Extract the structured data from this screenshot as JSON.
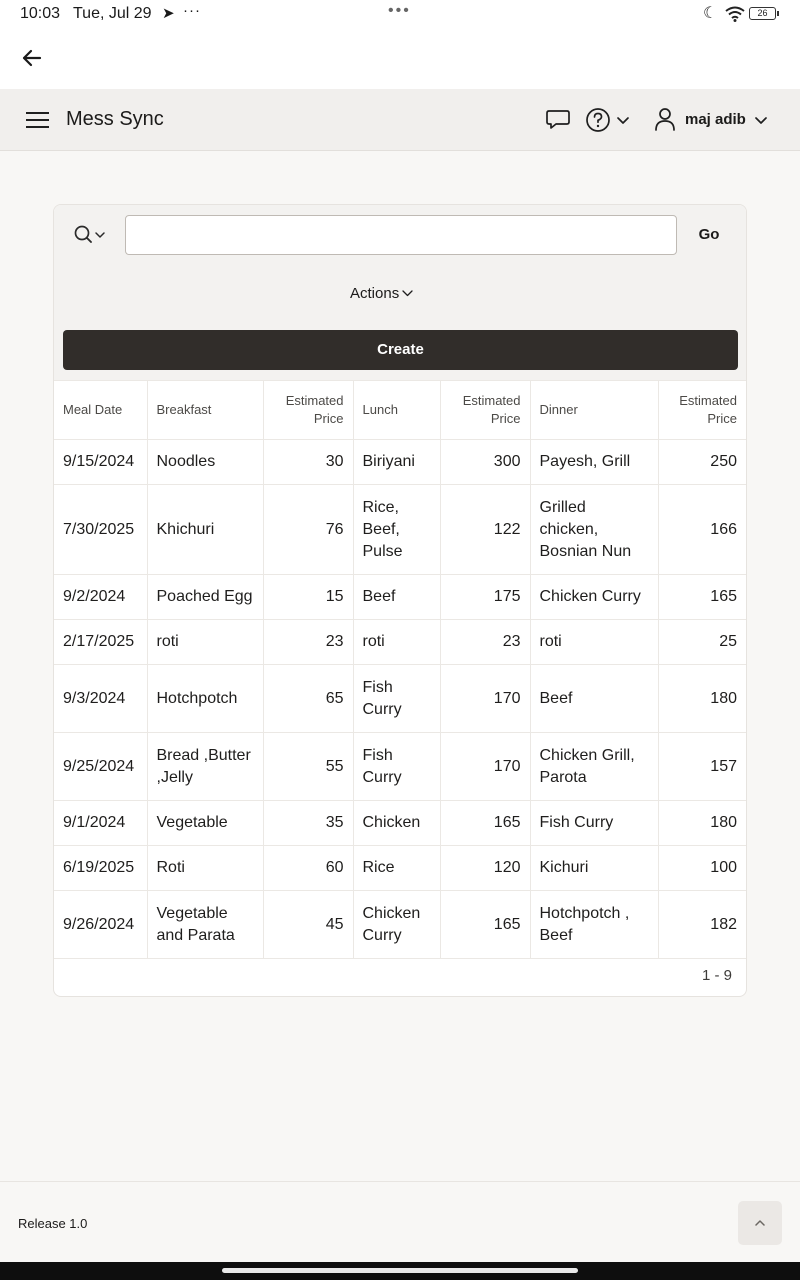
{
  "status": {
    "time": "10:03",
    "date": "Tue, Jul 29",
    "more": "···",
    "center_dots": "•••",
    "battery": "26"
  },
  "header": {
    "app_title": "Mess Sync",
    "user_name": "maj adib"
  },
  "toolbar": {
    "search_value": "",
    "go_label": "Go",
    "actions_label": "Actions",
    "create_label": "Create"
  },
  "table": {
    "columns": [
      {
        "label": "Meal Date",
        "numeric": false
      },
      {
        "label": "Breakfast",
        "numeric": false
      },
      {
        "label": "Estimated Price",
        "numeric": true
      },
      {
        "label": "Lunch",
        "numeric": false
      },
      {
        "label": "Estimated Price",
        "numeric": true
      },
      {
        "label": "Dinner",
        "numeric": false
      },
      {
        "label": "Estimated Price",
        "numeric": true
      }
    ],
    "rows": [
      [
        "9/15/2024",
        "Noodles",
        "30",
        "Biriyani",
        "300",
        "Payesh, Grill",
        "250"
      ],
      [
        "7/30/2025",
        "Khichuri",
        "76",
        "Rice, Beef, Pulse",
        "122",
        "Grilled chicken, Bosnian Nun",
        "166"
      ],
      [
        "9/2/2024",
        "Poached Egg",
        "15",
        "Beef",
        "175",
        "Chicken Curry",
        "165"
      ],
      [
        "2/17/2025",
        "roti",
        "23",
        "roti",
        "23",
        "roti",
        "25"
      ],
      [
        "9/3/2024",
        "Hotchpotch",
        "65",
        "Fish Curry",
        "170",
        "Beef",
        "180"
      ],
      [
        "9/25/2024",
        "Bread ,Butter ,Jelly",
        "55",
        "Fish Curry",
        "170",
        "Chicken Grill, Parota",
        "157"
      ],
      [
        "9/1/2024",
        "Vegetable",
        "35",
        "Chicken",
        "165",
        "Fish Curry",
        "180"
      ],
      [
        "6/19/2025",
        "Roti",
        "60",
        "Rice",
        "120",
        "Kichuri",
        "100"
      ],
      [
        "9/26/2024",
        "Vegetable and Parata",
        "45",
        "Chicken Curry",
        "165",
        "Hotchpotch , Beef",
        "182"
      ]
    ],
    "pagination": "1 - 9"
  },
  "footer": {
    "release": "Release 1.0"
  },
  "icons": {
    "back": "arrow-left-icon",
    "menu": "hamburger-icon",
    "chat": "chat-bubble-icon",
    "help": "question-circle-icon",
    "user": "user-icon",
    "search": "search-icon",
    "scroll_top": "chevron-up-icon"
  }
}
